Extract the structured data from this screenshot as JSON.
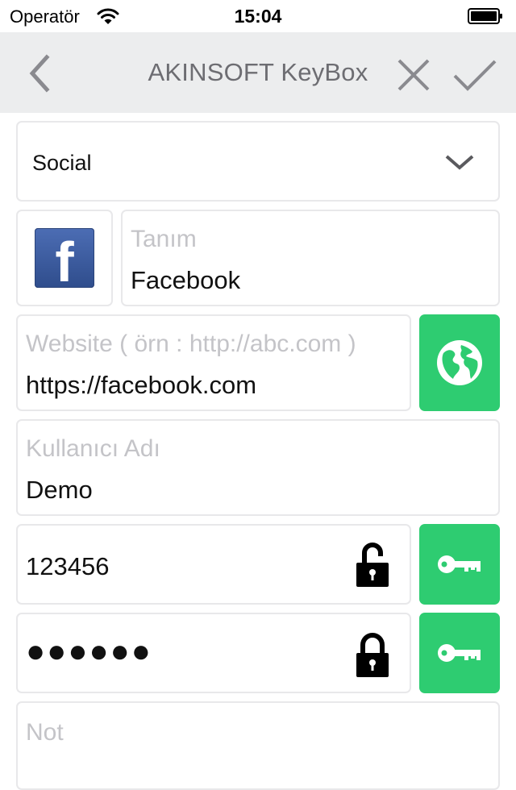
{
  "status_bar": {
    "carrier": "Operatör",
    "time": "15:04",
    "wifi_icon": "wifi-icon",
    "battery_icon": "battery-icon"
  },
  "nav": {
    "title": "AKINSOFT KeyBox",
    "back_icon": "chevron-left-icon",
    "cancel_icon": "close-icon",
    "save_icon": "checkmark-icon"
  },
  "form": {
    "category": {
      "value": "Social",
      "icon": "chevron-down-icon"
    },
    "entry_icon": {
      "name": "facebook-logo-icon",
      "glyph": "f"
    },
    "name": {
      "placeholder": "Tanım",
      "value": "Facebook"
    },
    "website": {
      "placeholder": "Website ( örn : http://abc.com )",
      "value": "https://facebook.com",
      "button_icon": "globe-icon"
    },
    "username": {
      "placeholder": "Kullanıcı Adı",
      "value": "Demo"
    },
    "password_visible": {
      "value": "123456",
      "lock_icon": "unlocked-padlock-icon",
      "button_icon": "key-icon"
    },
    "password_masked": {
      "value": "●●●●●●",
      "lock_icon": "locked-padlock-icon",
      "button_icon": "key-icon"
    },
    "note": {
      "placeholder": "Not",
      "value": ""
    }
  },
  "colors": {
    "accent_green": "#2ecc71",
    "nav_background": "#ecedee",
    "nav_icons": "#8a8a8f",
    "facebook_blue": "#3b5998",
    "placeholder_gray": "#c4c4c8"
  }
}
